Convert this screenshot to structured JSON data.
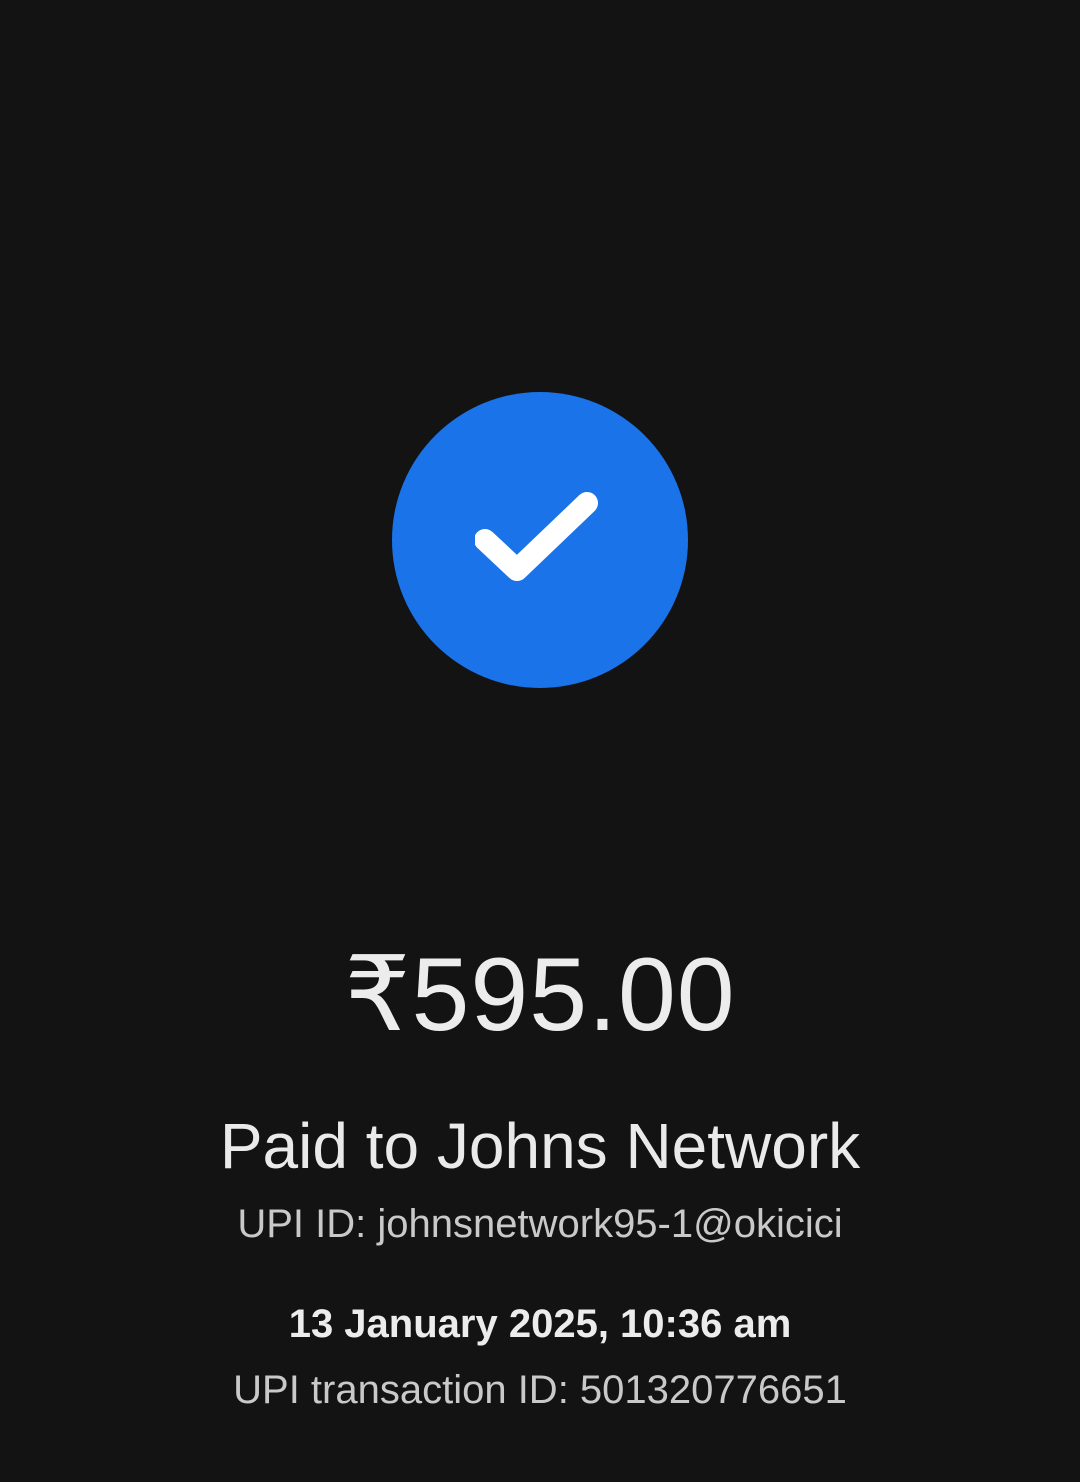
{
  "status": {
    "icon": "check-circle-icon",
    "accent_color": "#1a73e8"
  },
  "payment": {
    "amount": "₹595.00",
    "paid_to": "Paid to Johns Network",
    "upi_id": "UPI ID: johnsnetwork95-1@okicici",
    "datetime": "13 January 2025, 10:36 am",
    "transaction_id": "UPI transaction ID: 501320776651"
  }
}
